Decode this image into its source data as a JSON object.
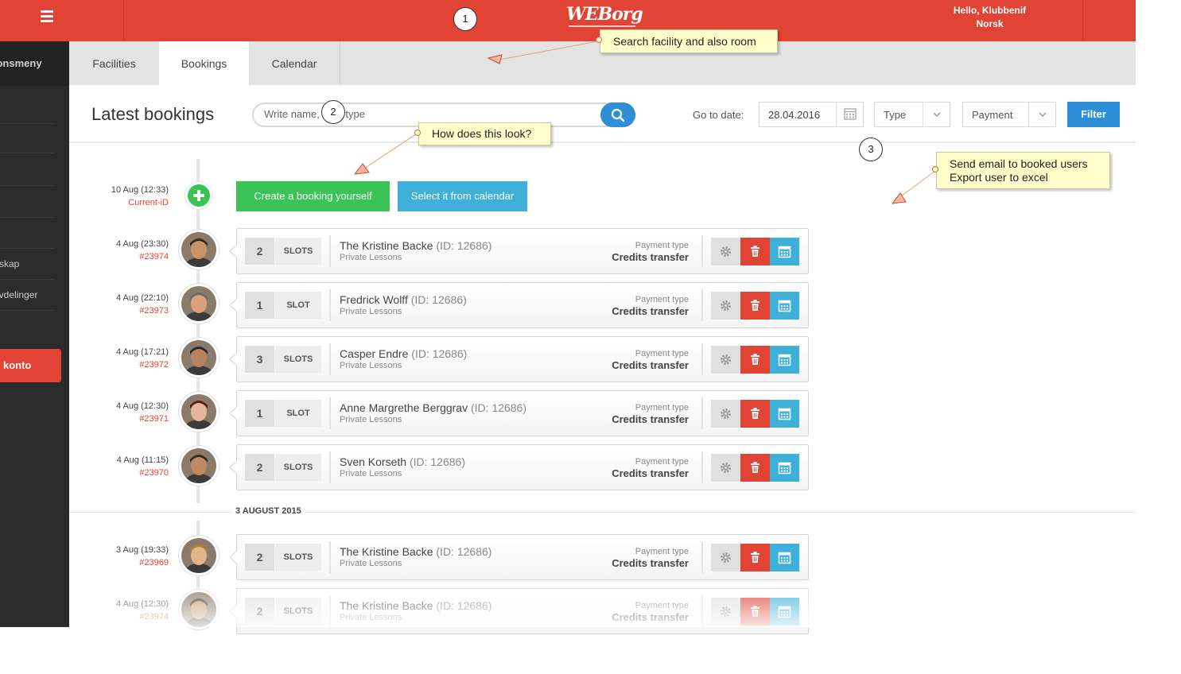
{
  "header": {
    "menu_icon": "hamburger-icon",
    "logo": "WEBorg",
    "greeting": "Hello, Klubbenif",
    "language": "Norsk"
  },
  "sidebar": {
    "section_label": "Navigasjonsmeny",
    "items": [
      "skap",
      "avdelinger"
    ],
    "account_button": "Min konto"
  },
  "tabs": [
    {
      "label": "Facilities",
      "active": false
    },
    {
      "label": "Bookings",
      "active": true
    },
    {
      "label": "Calendar",
      "active": false
    }
  ],
  "toolbar": {
    "title": "Latest bookings",
    "search_placeholder": "Write name, id or type",
    "goto_label": "Go to date:",
    "date_value": "28.04.2016",
    "type_select": "Type",
    "payment_select": "Payment",
    "filter_label": "Filter"
  },
  "new_booking": {
    "time": "10 Aug (12:33)",
    "id": "Current-iD",
    "create_label": "Create a booking yourself",
    "calendar_label": "Select it from calendar"
  },
  "bookings": [
    {
      "time": "4 Aug (23:30)",
      "id": "#23974",
      "slots": "2",
      "slot_label": "SLOTS",
      "name": "The Kristine Backe",
      "user_id": "(ID: 12686)",
      "type": "Private Lessons",
      "payment_label": "Payment type",
      "payment": "Credits transfer"
    },
    {
      "time": "4 Aug (22:10)",
      "id": "#23973",
      "slots": "1",
      "slot_label": "SLOT",
      "name": "Fredrick Wolff",
      "user_id": "(ID: 12686)",
      "type": "Private Lessons",
      "payment_label": "Payment type",
      "payment": "Credits transfer"
    },
    {
      "time": "4 Aug (17:21)",
      "id": "#23972",
      "slots": "3",
      "slot_label": "SLOTS",
      "name": "Casper Endre",
      "user_id": "(ID: 12686)",
      "type": "Private Lessons",
      "payment_label": "Payment type",
      "payment": "Credits transfer"
    },
    {
      "time": "4 Aug (12:30)",
      "id": "#23971",
      "slots": "1",
      "slot_label": "SLOT",
      "name": "Anne Margrethe Berggrav",
      "user_id": "(ID: 12686)",
      "type": "Private Lessons",
      "payment_label": "Payment type",
      "payment": "Credits transfer"
    },
    {
      "time": "4 Aug (11:15)",
      "id": "#23970",
      "slots": "2",
      "slot_label": "SLOTS",
      "name": "Sven Korseth",
      "user_id": "(ID: 12686)",
      "type": "Private Lessons",
      "payment_label": "Payment type",
      "payment": "Credits transfer"
    }
  ],
  "section_header": "3 AUGUST 2015",
  "bookings_prev": [
    {
      "time": "3 Aug (19:33)",
      "id": "#23969",
      "slots": "2",
      "slot_label": "SLOTS",
      "name": "The Kristine Backe",
      "user_id": "(ID: 12686)",
      "type": "Private Lessons",
      "payment_label": "Payment type",
      "payment": "Credits transfer"
    },
    {
      "time": "4 Aug (12:30)",
      "id": "#23974",
      "slots": "2",
      "slot_label": "SLOTS",
      "name": "The Kristine Backe",
      "user_id": "(ID: 12686)",
      "type": "Private Lessons",
      "payment_label": "Payment type",
      "payment": "Credits transfer"
    }
  ],
  "annotations": {
    "markers": [
      "1",
      "2",
      "3"
    ],
    "note1": "Search facility and also room",
    "note2": "How does this look?",
    "note3_line1": "Send email to booked users",
    "note3_line2": "Export user to excel"
  },
  "colors": {
    "brand": "#e14434",
    "primary_blue": "#2f8fd6",
    "green": "#3ac456",
    "light_blue": "#3fb0d8"
  },
  "icons": [
    "hamburger-icon",
    "search-icon",
    "calendar-icon",
    "chevron-down-icon",
    "plus-icon",
    "gear-icon",
    "trash-icon",
    "calendar-icon"
  ]
}
